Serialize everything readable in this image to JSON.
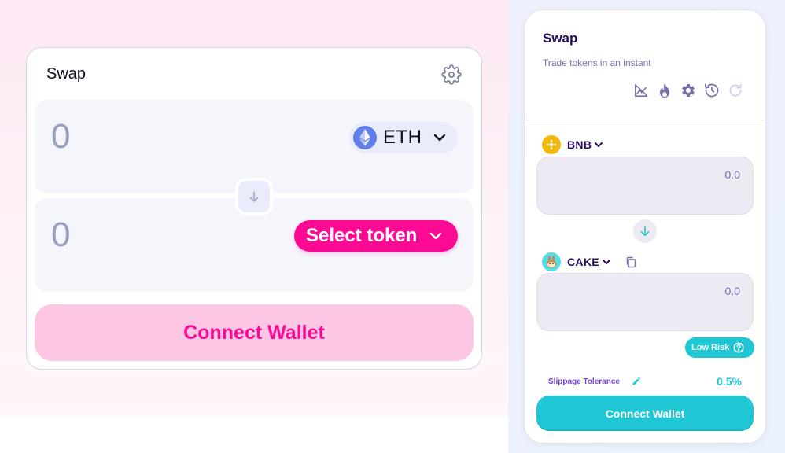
{
  "uniswap": {
    "title": "Swap",
    "input_amount": "0",
    "input_token": "ETH",
    "output_amount": "0",
    "select_token_label": "Select token",
    "connect_label": "Connect Wallet",
    "icons": [
      "gear-icon",
      "ethereum-icon",
      "chevron-down-icon",
      "arrow-down-icon"
    ],
    "colors": {
      "accent": "#fc0a93",
      "accent_soft": "#fdc7e4",
      "panel": "#f5f6fc"
    }
  },
  "pancake": {
    "title": "Swap",
    "subtitle": "Trade tokens in an instant",
    "toolbar_icons": [
      "chart-off-icon",
      "fire-icon",
      "gear-icon",
      "history-icon",
      "refresh-icon"
    ],
    "from_token": "BNB",
    "from_amount": "0.0",
    "to_token": "CAKE",
    "to_amount": "0.0",
    "risk_label": "Low Risk",
    "slippage_label": "Slippage Tolerance",
    "slippage_value": "0.5%",
    "connect_label": "Connect Wallet",
    "colors": {
      "primary": "#1fc7d4",
      "text": "#280d5f",
      "secondary": "#7645d9"
    }
  }
}
